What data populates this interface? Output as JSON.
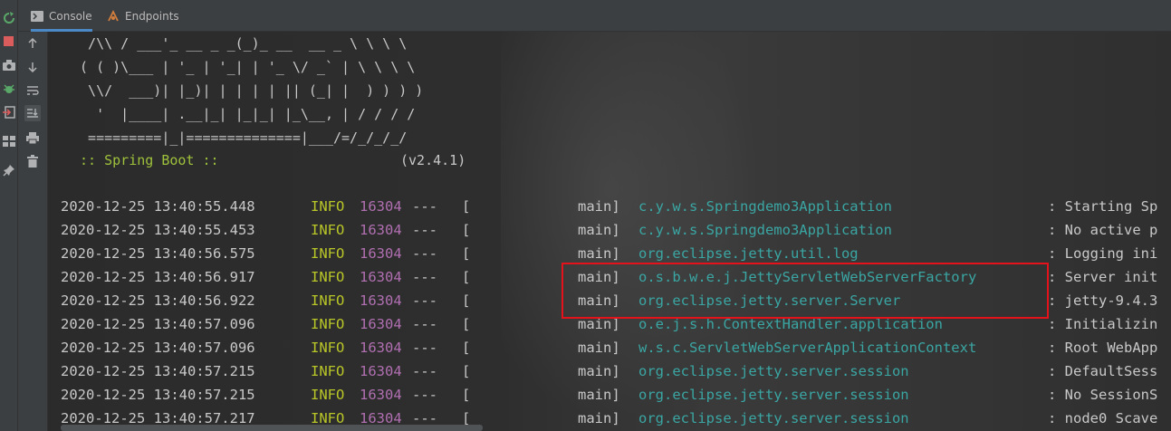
{
  "tabs": [
    {
      "label": "Console",
      "icon": "console-icon",
      "active": true
    },
    {
      "label": "Endpoints",
      "icon": "endpoints-icon",
      "active": false
    }
  ],
  "left_toolbar": [
    "rerun-icon",
    "stop-icon",
    "camera-icon",
    "debug-icon",
    "exit-icon",
    "layout-icon",
    "pin-icon"
  ],
  "console_toolbar": [
    "up-arrow-icon",
    "down-arrow-icon",
    "soft-wrap-icon",
    "scroll-to-end-icon",
    "print-icon",
    "trash-icon"
  ],
  "banner": [
    "  /\\\\ / ___'_ __ _ _(_)_ __  __ _ \\ \\ \\ \\",
    " ( ( )\\___ | '_ | '_| | '_ \\/ _` | \\ \\ \\ \\",
    "  \\\\/  ___)| |_)| | | | | || (_| |  ) ) ) )",
    "   '  |____| .__|_| |_|_| |_\\__, | / / / /",
    "  =========|_|==============|___/=/_/_/_/"
  ],
  "boot_label": " :: Spring Boot ::",
  "boot_version": "(v2.4.1)",
  "log_lines": [
    {
      "ts": "2020-12-25 13:40:55.448",
      "level": "INFO",
      "pid": "16304",
      "sep": "---",
      "bracket": "[",
      "thread": "main]",
      "logger": "c.y.w.s.Springdemo3Application",
      "msg": ": Starting Sp"
    },
    {
      "ts": "2020-12-25 13:40:55.453",
      "level": "INFO",
      "pid": "16304",
      "sep": "---",
      "bracket": "[",
      "thread": "main]",
      "logger": "c.y.w.s.Springdemo3Application",
      "msg": ": No active p"
    },
    {
      "ts": "2020-12-25 13:40:56.575",
      "level": "INFO",
      "pid": "16304",
      "sep": "---",
      "bracket": "[",
      "thread": "main]",
      "logger": "org.eclipse.jetty.util.log",
      "msg": ": Logging ini"
    },
    {
      "ts": "2020-12-25 13:40:56.917",
      "level": "INFO",
      "pid": "16304",
      "sep": "---",
      "bracket": "[",
      "thread": "main]",
      "logger": "o.s.b.w.e.j.JettyServletWebServerFactory",
      "msg": ": Server init"
    },
    {
      "ts": "2020-12-25 13:40:56.922",
      "level": "INFO",
      "pid": "16304",
      "sep": "---",
      "bracket": "[",
      "thread": "main]",
      "logger": "org.eclipse.jetty.server.Server",
      "msg": ": jetty-9.4.3"
    },
    {
      "ts": "2020-12-25 13:40:57.096",
      "level": "INFO",
      "pid": "16304",
      "sep": "---",
      "bracket": "[",
      "thread": "main]",
      "logger": "o.e.j.s.h.ContextHandler.application",
      "msg": ": Initializin"
    },
    {
      "ts": "2020-12-25 13:40:57.096",
      "level": "INFO",
      "pid": "16304",
      "sep": "---",
      "bracket": "[",
      "thread": "main]",
      "logger": "w.s.c.ServletWebServerApplicationContext",
      "msg": ": Root WebApp"
    },
    {
      "ts": "2020-12-25 13:40:57.215",
      "level": "INFO",
      "pid": "16304",
      "sep": "---",
      "bracket": "[",
      "thread": "main]",
      "logger": "org.eclipse.jetty.server.session",
      "msg": ": DefaultSess"
    },
    {
      "ts": "2020-12-25 13:40:57.215",
      "level": "INFO",
      "pid": "16304",
      "sep": "---",
      "bracket": "[",
      "thread": "main]",
      "logger": "org.eclipse.jetty.server.session",
      "msg": ": No SessionS"
    },
    {
      "ts": "2020-12-25 13:40:57.217",
      "level": "INFO",
      "pid": "16304",
      "sep": "---",
      "bracket": "[",
      "thread": "main]",
      "logger": "org.eclipse.jetty.server.session",
      "msg": ": node0 Scave"
    }
  ],
  "colors": {
    "timestamp": "#c8c8c8",
    "level": "#b9c627",
    "pid": "#b06fb0",
    "logger": "#3aa6a3",
    "boot": "#9fc23b",
    "highlight": "#e4121b"
  }
}
